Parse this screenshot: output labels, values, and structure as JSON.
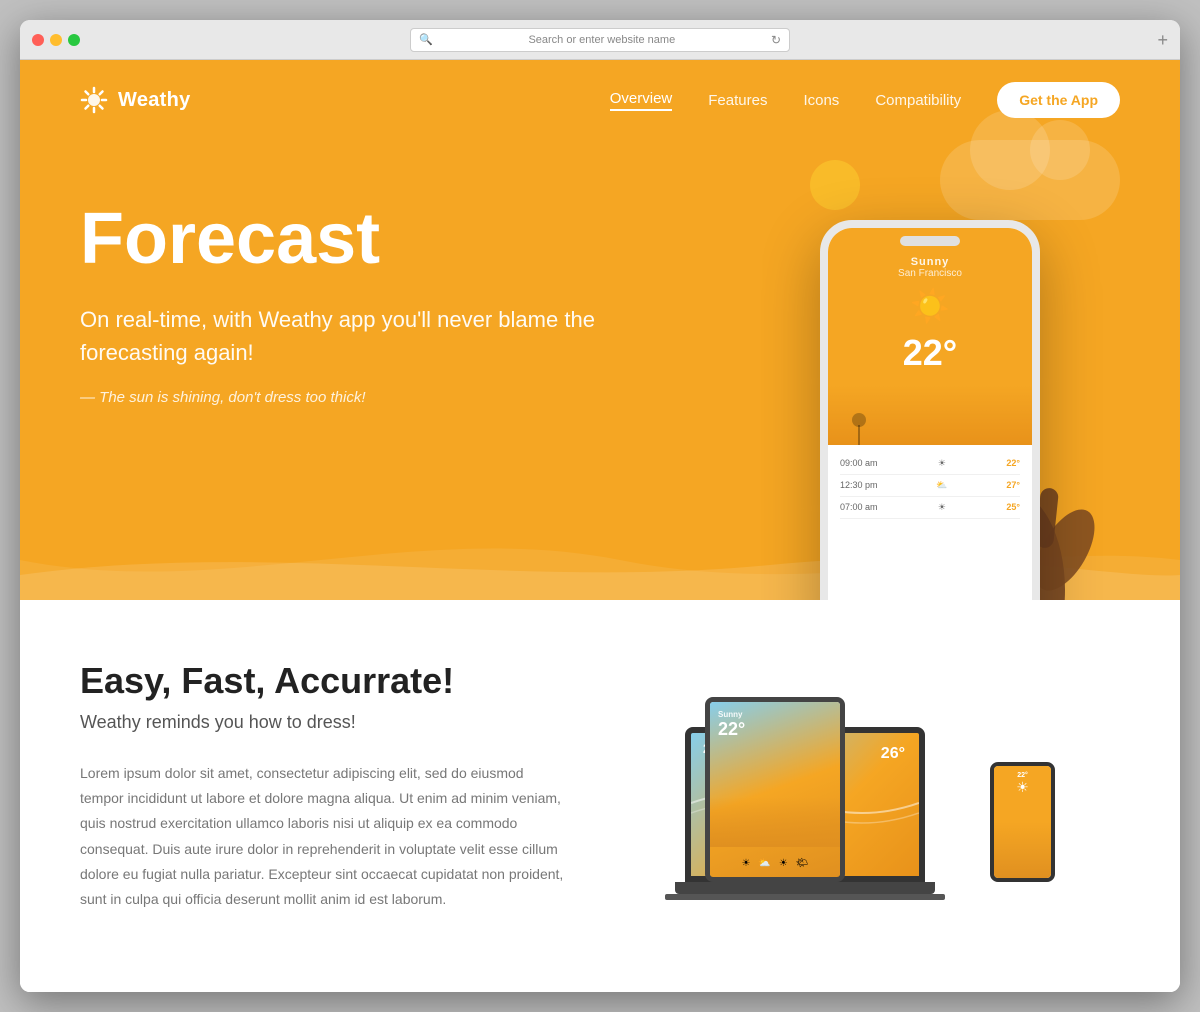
{
  "browser": {
    "address_placeholder": "Search or enter website name"
  },
  "nav": {
    "logo_text": "Weathy",
    "links": [
      {
        "label": "Overview",
        "active": true
      },
      {
        "label": "Features",
        "active": false
      },
      {
        "label": "Icons",
        "active": false
      },
      {
        "label": "Compatibility",
        "active": false
      }
    ],
    "cta_label": "Get the App"
  },
  "hero": {
    "title": "Forecast",
    "subtitle": "On real-time, with Weathy app you'll never blame the forecasting again!",
    "tagline": "— The sun is shining, don't dress too thick!",
    "phone": {
      "condition": "Sunny",
      "temperature": "22°",
      "rows": [
        {
          "time": "09:00 am",
          "icon": "☀",
          "temp": "22°"
        },
        {
          "time": "12:30 pm",
          "icon": "⛅",
          "temp": "27°"
        },
        {
          "time": "07:00 am",
          "icon": "☀",
          "temp": "25°"
        }
      ]
    }
  },
  "features": {
    "title": "Easy, Fast, Accurrate!",
    "tagline": "Weathy reminds you how to dress!",
    "body": "Lorem ipsum dolor sit amet, consectetur adipiscing elit, sed do eiusmod tempor incididunt ut labore et dolore magna aliqua. Ut enim ad minim veniam, quis nostrud exercitation ullamco laboris nisi ut aliquip ex ea commodo consequat. Duis aute irure dolor in reprehenderit in voluptate velit esse cillum dolore eu fugiat nulla pariatur. Excepteur sint occaecat cupidatat non proident, sunt in culpa qui officia deserunt mollit anim id est laborum."
  },
  "colors": {
    "brand_yellow": "#F5A623",
    "brand_dark_yellow": "#e8921a",
    "text_dark": "#222222",
    "text_medium": "#555555",
    "text_light": "#777777"
  }
}
